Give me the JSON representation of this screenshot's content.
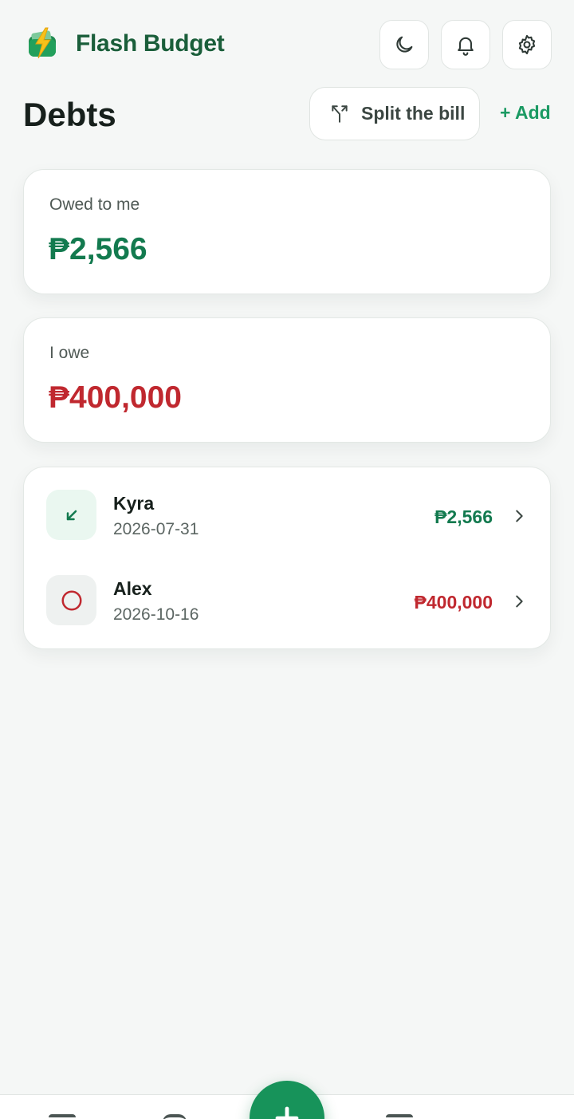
{
  "app": {
    "title": "Flash Budget",
    "logo_icon": "lightning-wallet-icon"
  },
  "header": {
    "theme_icon": "moon-icon",
    "notifications_icon": "bell-icon",
    "settings_icon": "gear-icon"
  },
  "page": {
    "title": "Debts",
    "split_label": "Split the bill",
    "split_icon": "split-arrows-icon",
    "add_label": "+ Add"
  },
  "summary": {
    "owed_to_me_label": "Owed to me",
    "owed_to_me_value": "₱2,566",
    "i_owe_label": "I owe",
    "i_owe_value": "₱400,000"
  },
  "debts": [
    {
      "name": "Kyra",
      "date": "2026-07-31",
      "amount": "₱2,566",
      "direction": "owed-to-me",
      "icon": "arrow-down-left-icon"
    },
    {
      "name": "Alex",
      "date": "2026-10-16",
      "amount": "₱400,000",
      "direction": "i-owe",
      "icon": "circle-icon"
    }
  ],
  "colors": {
    "brand": "#1a5e3a",
    "accent": "#1b9a63",
    "positive": "#137a4f",
    "negative": "#c0282f",
    "background": "#f5f7f6"
  },
  "nav": {
    "fab_icon": "plus-icon"
  }
}
